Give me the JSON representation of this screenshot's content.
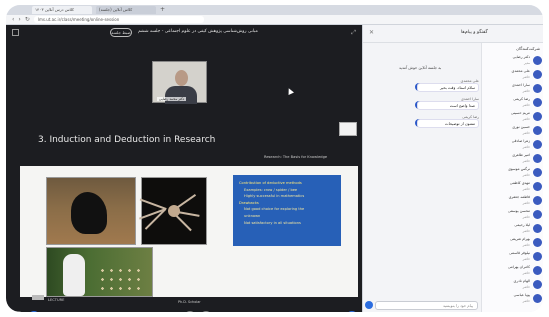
{
  "browser": {
    "tabs": [
      "کلاس درس آنلاین ۱۴۰۳",
      "(جلسه) کلاس آنلاین"
    ],
    "url": "lms.ut.ac.ir/class/meeting/online-session"
  },
  "meeting": {
    "title": "مبانی روش‌شناسی پژوهش کیفی در علوم اجتماعی - جلسه ششم",
    "record_label": "ضبط جلسه",
    "presenter_name": "دکتر محمد رضایی",
    "slide": {
      "title": "3. Induction and Deduction in Research",
      "reference": "Research: The Basis for Knowledge",
      "box_lines": [
        {
          "text": "Contribution of deductive methods",
          "kind": "head"
        },
        {
          "text": "Examples: crow / spider / bee",
          "kind": "sub"
        },
        {
          "text": "Highly successful in mathematics",
          "kind": "sub"
        },
        {
          "text": "Drawbacks",
          "kind": "head"
        },
        {
          "text": "Not good choice for exploring the",
          "kind": "sub"
        },
        {
          "text": "unknown",
          "kind": "sub"
        },
        {
          "text": "Not satisfactory in all situations",
          "kind": "sub"
        }
      ],
      "footer_left": "LECTURE",
      "footer_mid": "Ph.D. Scholar"
    }
  },
  "sidebar": {
    "title": "گفتگو و پیام‌ها",
    "system_message": "به جلسه آنلاین خوش آمدید",
    "messages": [
      {
        "name": "علی محمدی",
        "text": "سلام استاد، وقت بخیر"
      },
      {
        "name": "سارا احمدی",
        "text": "صدا واضح است"
      },
      {
        "name": "رضا کریمی",
        "text": "ممنون از توضیحات"
      }
    ],
    "input_placeholder": "پیام خود را بنویسید",
    "participants_header": "شرکت‌کنندگان",
    "participants": [
      {
        "name": "دکتر رضایی",
        "role": "مدیر"
      },
      {
        "name": "علی محمدی",
        "role": "حاضر"
      },
      {
        "name": "سارا احمدی",
        "role": "حاضر"
      },
      {
        "name": "رضا کریمی",
        "role": "حاضر"
      },
      {
        "name": "مریم حسینی",
        "role": "حاضر"
      },
      {
        "name": "حسین نوری",
        "role": "حاضر"
      },
      {
        "name": "زهرا صادقی",
        "role": "حاضر"
      },
      {
        "name": "امیر طاهری",
        "role": "حاضر"
      },
      {
        "name": "نرگس موسوی",
        "role": "حاضر"
      },
      {
        "name": "مهدی کاظمی",
        "role": "حاضر"
      },
      {
        "name": "فاطمه جعفری",
        "role": "حاضر"
      },
      {
        "name": "محسن یوسفی",
        "role": "حاضر"
      },
      {
        "name": "لیلا رحیمی",
        "role": "حاضر"
      },
      {
        "name": "بهرام شریفی",
        "role": "حاضر"
      },
      {
        "name": "نیلوفر قاسمی",
        "role": "حاضر"
      },
      {
        "name": "کامران بهرامی",
        "role": "حاضر"
      },
      {
        "name": "الهام نادری",
        "role": "حاضر"
      },
      {
        "name": "پویا عباسی",
        "role": "حاضر"
      }
    ]
  },
  "colors": {
    "accent": "#2b6de0",
    "slide_box": "#2760b7"
  }
}
